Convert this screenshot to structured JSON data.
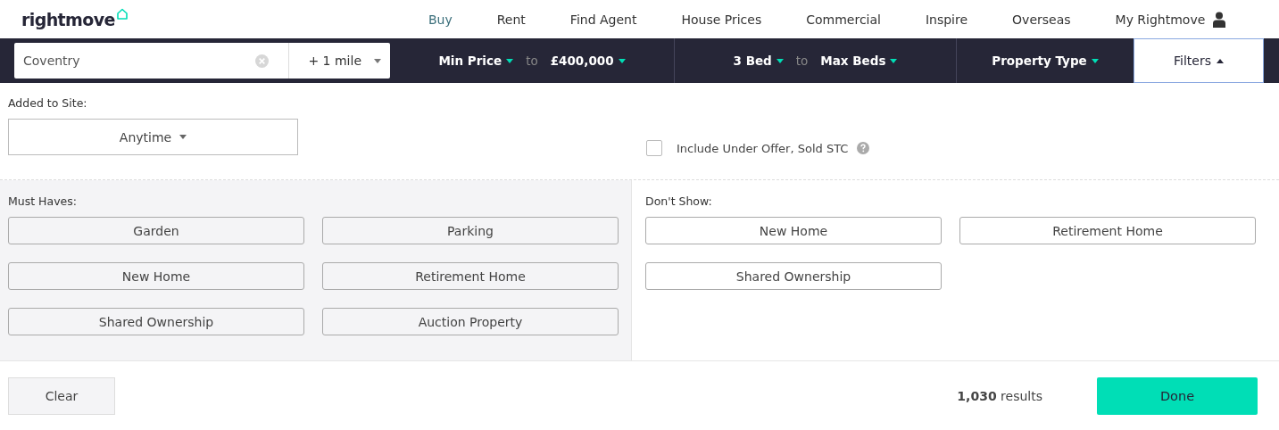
{
  "logo": {
    "text": "rightmove"
  },
  "nav": [
    {
      "label": "Buy",
      "selected": true
    },
    {
      "label": "Rent",
      "selected": false
    },
    {
      "label": "Find Agent",
      "selected": false
    },
    {
      "label": "House Prices",
      "selected": false
    },
    {
      "label": "Commercial",
      "selected": false
    },
    {
      "label": "Inspire",
      "selected": false
    },
    {
      "label": "Overseas",
      "selected": false
    },
    {
      "label": "My Rightmove",
      "selected": false
    }
  ],
  "search": {
    "value": "Coventry",
    "radius": "+ 1 mile"
  },
  "price": {
    "min": "Min Price",
    "separator": "to",
    "max": "£400,000"
  },
  "beds": {
    "min": "3 Bed",
    "separator": "to",
    "max": "Max Beds"
  },
  "property_type": "Property Type",
  "filters": {
    "label": "Filters",
    "expanded": true
  },
  "added_to_site": {
    "label": "Added to Site:",
    "value": "Anytime"
  },
  "include_under_offer": {
    "label": "Include Under Offer, Sold STC",
    "checked": false
  },
  "must_haves": {
    "label": "Must Haves:",
    "options": [
      {
        "label": "Garden",
        "selected": false
      },
      {
        "label": "Parking",
        "selected": false
      },
      {
        "label": "New Home",
        "selected": false
      },
      {
        "label": "Retirement Home",
        "selected": false
      },
      {
        "label": "Shared Ownership",
        "selected": false
      },
      {
        "label": "Auction Property",
        "selected": false
      }
    ]
  },
  "dont_show": {
    "label": "Don't Show:",
    "options": [
      {
        "label": "New Home",
        "selected": false
      },
      {
        "label": "Retirement Home",
        "selected": false
      },
      {
        "label": "Shared Ownership",
        "selected": false
      }
    ]
  },
  "footer": {
    "clear": "Clear",
    "results": "**1,030** results",
    "done": "Done"
  }
}
